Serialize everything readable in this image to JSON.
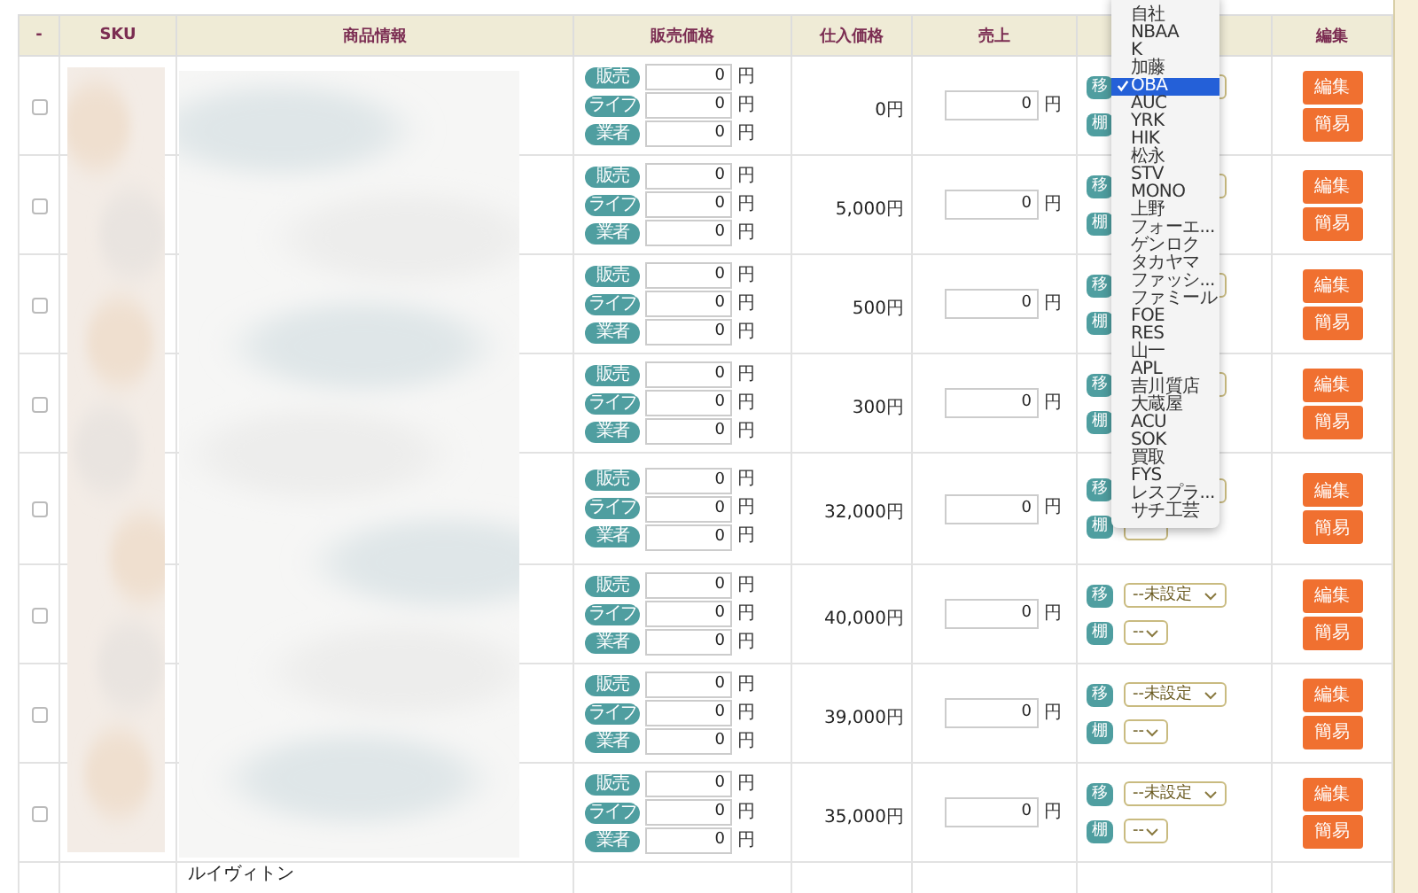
{
  "table": {
    "columns": [
      "-",
      "SKU",
      "商品情報",
      "販売価格",
      "仕入価格",
      "売上",
      null,
      "編集"
    ],
    "rows": [
      {
        "checked": false,
        "prices": [
          {
            "badge": "販売",
            "value": "0",
            "unit": "円"
          },
          {
            "badge": "ライブ",
            "value": "0",
            "unit": "円"
          },
          {
            "badge": "業者",
            "value": "0",
            "unit": "円"
          }
        ],
        "cost": {
          "value": "0",
          "unit": "円"
        },
        "sales": {
          "value": "0",
          "unit": "円"
        },
        "store": [
          {
            "badge": "移",
            "kind": "select"
          },
          {
            "badge": "棚",
            "kind": "tag"
          }
        ],
        "buttons": [
          "編集",
          "簡易"
        ]
      },
      {
        "checked": false,
        "prices": [
          {
            "badge": "販売",
            "value": "0",
            "unit": "円"
          },
          {
            "badge": "ライブ",
            "value": "0",
            "unit": "円"
          },
          {
            "badge": "業者",
            "value": "0",
            "unit": "円"
          }
        ],
        "cost": {
          "value": "5,000",
          "unit": "円"
        },
        "sales": {
          "value": "0",
          "unit": "円"
        },
        "store": [
          {
            "badge": "移",
            "kind": "select"
          },
          {
            "badge": "棚",
            "kind": "tag"
          }
        ],
        "buttons": [
          "編集",
          "簡易"
        ]
      },
      {
        "checked": false,
        "prices": [
          {
            "badge": "販売",
            "value": "0",
            "unit": "円"
          },
          {
            "badge": "ライブ",
            "value": "0",
            "unit": "円"
          },
          {
            "badge": "業者",
            "value": "0",
            "unit": "円"
          }
        ],
        "cost": {
          "value": "500",
          "unit": "円"
        },
        "sales": {
          "value": "0",
          "unit": "円"
        },
        "store": [
          {
            "badge": "移",
            "kind": "select"
          },
          {
            "badge": "棚",
            "kind": "tag"
          }
        ],
        "buttons": [
          "編集",
          "簡易"
        ]
      },
      {
        "checked": false,
        "prices": [
          {
            "badge": "販売",
            "value": "0",
            "unit": "円"
          },
          {
            "badge": "ライブ",
            "value": "0",
            "unit": "円"
          },
          {
            "badge": "業者",
            "value": "0",
            "unit": "円"
          }
        ],
        "cost": {
          "value": "300",
          "unit": "円"
        },
        "sales": {
          "value": "0",
          "unit": "円"
        },
        "store": [
          {
            "badge": "移",
            "kind": "select"
          },
          {
            "badge": "棚",
            "kind": "tag"
          }
        ],
        "buttons": [
          "編集",
          "簡易"
        ]
      },
      {
        "checked": false,
        "prices": [
          {
            "badge": "販売",
            "value": "0",
            "unit": "円"
          },
          {
            "badge": "ライブ",
            "value": "0",
            "unit": "円"
          },
          {
            "badge": "業者",
            "value": "0",
            "unit": "円"
          }
        ],
        "cost": {
          "value": "32,000",
          "unit": "円"
        },
        "sales": {
          "value": "0",
          "unit": "円"
        },
        "store": [
          {
            "badge": "移",
            "kind": "select"
          },
          {
            "badge": "棚",
            "kind": "select"
          }
        ],
        "buttons": [
          "編集",
          "簡易"
        ]
      },
      {
        "checked": false,
        "prices": [
          {
            "badge": "販売",
            "value": "0",
            "unit": "円"
          },
          {
            "badge": "ライブ",
            "value": "0",
            "unit": "円"
          },
          {
            "badge": "業者",
            "value": "0",
            "unit": "円"
          }
        ],
        "cost": {
          "value": "40,000",
          "unit": "円"
        },
        "sales": {
          "value": "0",
          "unit": "円"
        },
        "store": [
          {
            "badge": "移",
            "value": "--未設定"
          },
          {
            "badge": "棚",
            "value": "--"
          }
        ],
        "buttons": [
          "編集",
          "簡易"
        ]
      },
      {
        "checked": false,
        "prices": [
          {
            "badge": "販売",
            "value": "0",
            "unit": "円"
          },
          {
            "badge": "ライブ",
            "value": "0",
            "unit": "円"
          },
          {
            "badge": "業者",
            "value": "0",
            "unit": "円"
          }
        ],
        "cost": {
          "value": "39,000",
          "unit": "円"
        },
        "sales": {
          "value": "0",
          "unit": "円"
        },
        "store": [
          {
            "badge": "移",
            "value": "--未設定"
          },
          {
            "badge": "棚",
            "value": "--"
          }
        ],
        "buttons": [
          "編集",
          "簡易"
        ]
      },
      {
        "checked": false,
        "prices": [
          {
            "badge": "販売",
            "value": "0",
            "unit": "円"
          },
          {
            "badge": "ライブ",
            "value": "0",
            "unit": "円"
          },
          {
            "badge": "業者",
            "value": "0",
            "unit": "円"
          }
        ],
        "cost": {
          "value": "35,000",
          "unit": "円"
        },
        "sales": {
          "value": "0",
          "unit": "円"
        },
        "store": [
          {
            "badge": "移",
            "value": "--未設定"
          },
          {
            "badge": "棚",
            "value": "--"
          }
        ],
        "buttons": [
          "編集",
          "簡易"
        ]
      },
      {
        "product": "ルイヴィトン"
      }
    ]
  },
  "dropdown": {
    "items": [
      {
        "label": "自社",
        "selected": false
      },
      {
        "label": "NBAA",
        "selected": false
      },
      {
        "label": "K",
        "selected": false
      },
      {
        "label": "加藤",
        "selected": false
      },
      {
        "label": "OBA",
        "selected": true
      },
      {
        "label": "AUC",
        "selected": false
      },
      {
        "label": "YRK",
        "selected": false
      },
      {
        "label": "HIK",
        "selected": false
      },
      {
        "label": "松永",
        "selected": false
      },
      {
        "label": "STV",
        "selected": false
      },
      {
        "label": "MONO",
        "selected": false
      },
      {
        "label": "上野",
        "selected": false
      },
      {
        "label": "フォーエ...",
        "selected": false
      },
      {
        "label": "ゲンロク",
        "selected": false
      },
      {
        "label": "タカヤマ",
        "selected": false
      },
      {
        "label": "ファッシ...",
        "selected": false
      },
      {
        "label": "ファミール",
        "selected": false
      },
      {
        "label": "FOE",
        "selected": false
      },
      {
        "label": "RES",
        "selected": false
      },
      {
        "label": "山一",
        "selected": false
      },
      {
        "label": "APL",
        "selected": false
      },
      {
        "label": "吉川質店",
        "selected": false
      },
      {
        "label": "大蔵屋",
        "selected": false
      },
      {
        "label": "ACU",
        "selected": false
      },
      {
        "label": "SOK",
        "selected": false
      },
      {
        "label": "買取",
        "selected": false
      },
      {
        "label": "FYS",
        "selected": false
      },
      {
        "label": "レスプラ...",
        "selected": false
      },
      {
        "label": "サチ工芸",
        "selected": false
      }
    ]
  }
}
